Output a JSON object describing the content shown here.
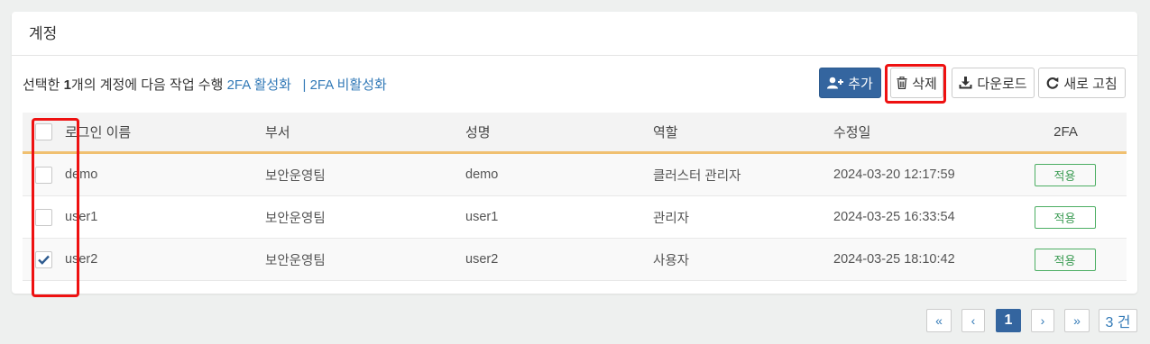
{
  "panel": {
    "title": "계정"
  },
  "action_bar": {
    "prefix": "선택한 ",
    "count": "1",
    "suffix": "개의 계정에 다음 작업 수행 ",
    "link_enable_2fa": "2FA 활성화",
    "separator": "|",
    "link_disable_2fa": "2FA 비활성화"
  },
  "toolbar": {
    "add_label": "추가",
    "delete_label": "삭제",
    "download_label": "다운로드",
    "refresh_label": "새로 고침"
  },
  "table": {
    "headers": {
      "login": "로그인 이름",
      "dept": "부서",
      "name": "성명",
      "role": "역할",
      "modified": "수정일",
      "twofa": "2FA"
    },
    "rows": [
      {
        "checked": false,
        "login": "demo",
        "dept": "보안운영팀",
        "name": "demo",
        "role": "클러스터 관리자",
        "modified": "2024-03-20 12:17:59",
        "twofa": "적용"
      },
      {
        "checked": false,
        "login": "user1",
        "dept": "보안운영팀",
        "name": "user1",
        "role": "관리자",
        "modified": "2024-03-25 16:33:54",
        "twofa": "적용"
      },
      {
        "checked": true,
        "login": "user2",
        "dept": "보안운영팀",
        "name": "user2",
        "role": "사용자",
        "modified": "2024-03-25 18:10:42",
        "twofa": "적용"
      }
    ]
  },
  "pagination": {
    "first": "«",
    "prev": "‹",
    "current": "1",
    "next": "›",
    "last": "»",
    "total": "3 건"
  },
  "colors": {
    "primary": "#34659f",
    "link": "#337ab7",
    "header_accent": "#f0c070",
    "tag_green": "#3d9c55",
    "highlight": "#e11111"
  }
}
